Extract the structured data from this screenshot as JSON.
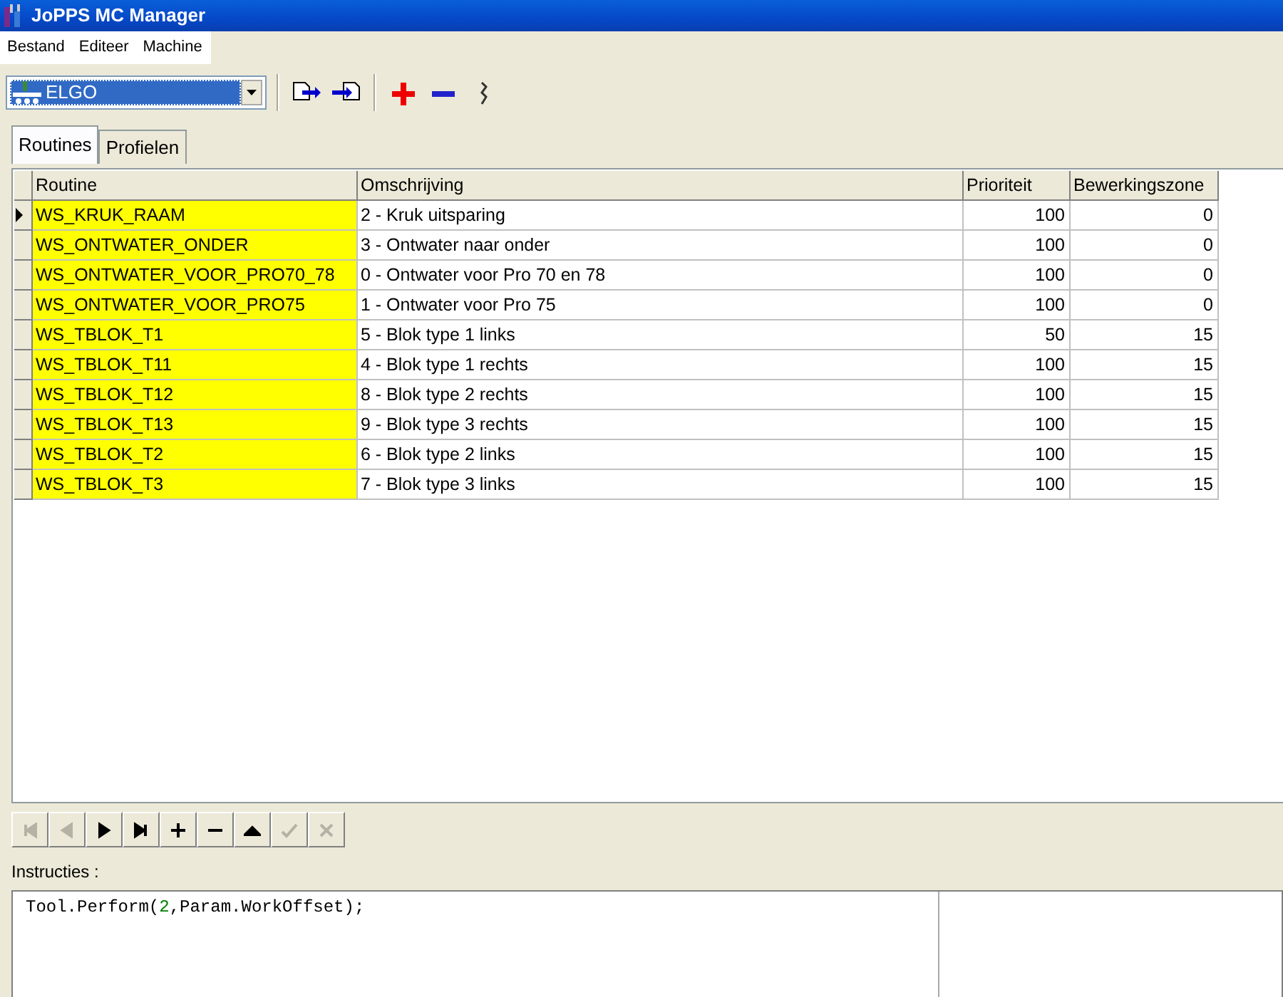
{
  "window": {
    "title": "JoPPS MC Manager"
  },
  "menu": [
    "Bestand",
    "Editeer",
    "Machine"
  ],
  "machine_select": {
    "value": "ELGO"
  },
  "toolbar": [
    {
      "kind": "export"
    },
    {
      "kind": "import"
    },
    {
      "kind": "add"
    },
    {
      "kind": "remove"
    },
    {
      "kind": "link"
    }
  ],
  "tabs": [
    {
      "label": "Routines",
      "selected": true
    },
    {
      "label": "Profielen",
      "selected": false
    }
  ],
  "table": {
    "columns": [
      "Routine",
      "Omschrijving",
      "Prioriteit",
      "Bewerkingszone"
    ],
    "rows": [
      {
        "current": true,
        "cells": [
          "WS_KRUK_RAAM",
          "2 - Kruk uitsparing",
          "100",
          "0"
        ]
      },
      {
        "current": false,
        "cells": [
          "WS_ONTWATER_ONDER",
          "3 - Ontwater naar onder",
          "100",
          "0"
        ]
      },
      {
        "current": false,
        "cells": [
          "WS_ONTWATER_VOOR_PRO70_78",
          "0 - Ontwater voor Pro 70 en 78",
          "100",
          "0"
        ]
      },
      {
        "current": false,
        "cells": [
          "WS_ONTWATER_VOOR_PRO75",
          "1 - Ontwater voor Pro 75",
          "100",
          "0"
        ]
      },
      {
        "current": false,
        "cells": [
          "WS_TBLOK_T1",
          "5 - Blok type 1 links",
          "50",
          "15"
        ]
      },
      {
        "current": false,
        "cells": [
          "WS_TBLOK_T11",
          "4 - Blok type 1 rechts",
          "100",
          "15"
        ]
      },
      {
        "current": false,
        "cells": [
          "WS_TBLOK_T12",
          "8 - Blok type 2 rechts",
          "100",
          "15"
        ]
      },
      {
        "current": false,
        "cells": [
          "WS_TBLOK_T13",
          "9 - Blok type 3 rechts",
          "100",
          "15"
        ]
      },
      {
        "current": false,
        "cells": [
          "WS_TBLOK_T2",
          "6 - Blok type 2 links",
          "100",
          "15"
        ]
      },
      {
        "current": false,
        "cells": [
          "WS_TBLOK_T3",
          "7 - Blok type 3 links",
          "100",
          "15"
        ]
      }
    ]
  },
  "navigator": [
    {
      "kind": "first",
      "disabled": true
    },
    {
      "kind": "prior",
      "disabled": true
    },
    {
      "kind": "next",
      "disabled": false
    },
    {
      "kind": "last",
      "disabled": false
    },
    {
      "kind": "insert",
      "disabled": false
    },
    {
      "kind": "delete",
      "disabled": false
    },
    {
      "kind": "edit",
      "disabled": false
    },
    {
      "kind": "post",
      "disabled": true
    },
    {
      "kind": "cancel",
      "disabled": true
    }
  ],
  "instructions": {
    "label": "Instructies :",
    "code": [
      {
        "kind": "plain",
        "text": "Tool.Perform("
      },
      {
        "kind": "number",
        "text": "2"
      },
      {
        "kind": "plain",
        "text": ",Param.WorkOffset);"
      }
    ]
  }
}
